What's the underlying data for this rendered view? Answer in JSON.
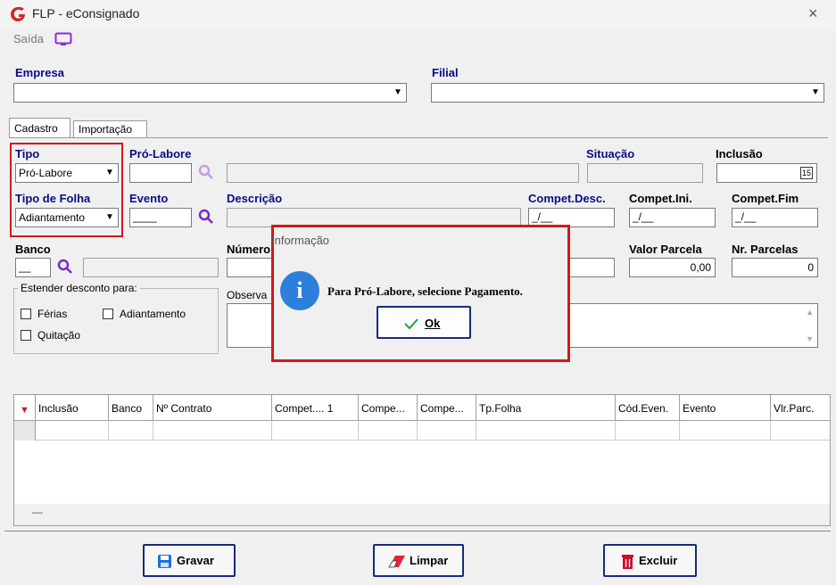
{
  "window": {
    "title": "FLP - eConsignado",
    "close": "×",
    "menu_saida": "Saída"
  },
  "filters": {
    "empresa_label": "Empresa",
    "filial_label": "Filial"
  },
  "tabs": [
    {
      "label": "Cadastro"
    },
    {
      "label": "Importação"
    }
  ],
  "form": {
    "tipo_label": "Tipo",
    "tipo_value": "Pró-Labore",
    "tipo_folha_label": "Tipo de Folha",
    "tipo_folha_value": "Adiantamento",
    "pro_labore_label": "Pró-Labore",
    "situacao_label": "Situação",
    "inclusao_label": "Inclusão",
    "evento_label": "Evento",
    "evento_value": "____",
    "descricao_label": "Descrição",
    "compet_desc_label": "Compet.Desc.",
    "compet_desc_value": "_/__",
    "compet_ini_label": "Compet.Ini.",
    "compet_ini_value": "_/__",
    "compet_fim_label": "Compet.Fim",
    "compet_fim_value": "_/__",
    "banco_label": "Banco",
    "banco_value": "__",
    "numero_label": "Número",
    "valor_parcela_label": "Valor Parcela",
    "valor_parcela_value": "0,00",
    "nr_parcelas_label": "Nr. Parcelas",
    "nr_parcelas_value": "0",
    "observacao_label": "Observa",
    "estender_label": "Estender desconto para:",
    "chk_ferias": "Férias",
    "chk_adiantamento": "Adiantamento",
    "chk_quitacao": "Quitação",
    "calendar_icon_text": "15"
  },
  "grid": {
    "columns": [
      "Inclusão",
      "Banco",
      "Nº Contrato",
      "Compet.... 1",
      "Compe...",
      "Compe...",
      "Tp.Folha",
      "Cód.Even.",
      "Evento",
      "Vlr.Parc."
    ],
    "footer_text": "—"
  },
  "buttons": {
    "gravar": "Gravar",
    "limpar": "Limpar",
    "excluir": "Excluir"
  },
  "dialog": {
    "title": "Informação",
    "message": "Para Pró-Labore, selecione Pagamento.",
    "ok": "Ok"
  },
  "colors": {
    "label_blue": "#0b0b85",
    "highlight_red": "#d01a1a",
    "button_border": "#1a2a7a",
    "info_blue": "#2d7fdc"
  }
}
